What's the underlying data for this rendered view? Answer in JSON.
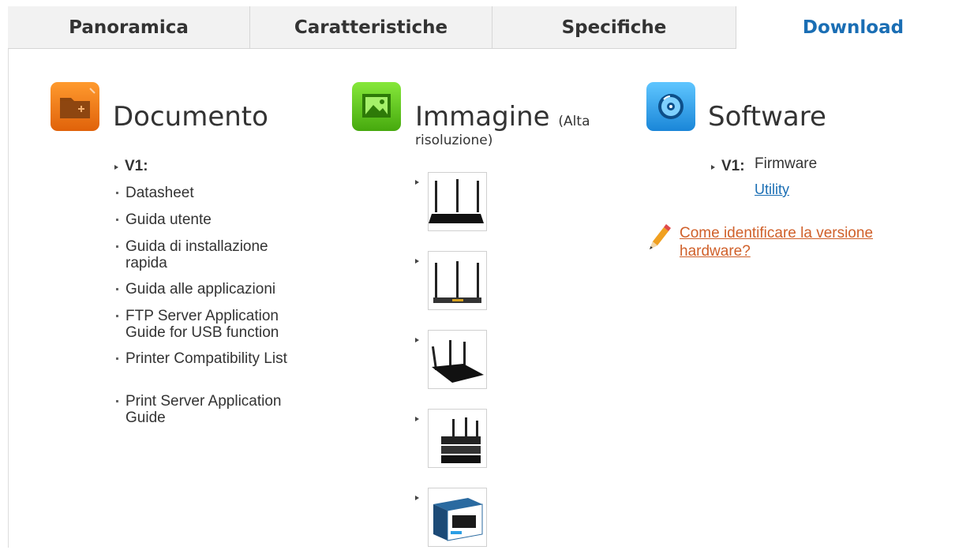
{
  "tabs": [
    {
      "label": "Panoramica"
    },
    {
      "label": "Caratteristiche"
    },
    {
      "label": "Specifiche"
    },
    {
      "label": "Download",
      "active": true
    }
  ],
  "documento": {
    "title": "Documento",
    "icon": "folder-icon",
    "color": "#f07a10",
    "version": "V1:",
    "items": [
      "Datasheet",
      "Guida utente",
      "Guida di installazione rapida",
      "Guida alle applicazioni",
      "FTP Server Application Guide for USB function",
      "Printer Compatibility List",
      "Print Server Application Guide"
    ]
  },
  "immagine": {
    "title": "Immagine",
    "subtitle_a": "(Alta",
    "subtitle_b": "risoluzione)",
    "icon": "picture-icon",
    "color": "#5fbf1c",
    "thumbnails": [
      "router-front-image",
      "router-back-image",
      "router-angle-image",
      "router-stack-image",
      "router-box-image"
    ]
  },
  "software": {
    "title": "Software",
    "icon": "disc-icon",
    "color": "#2a9fe6",
    "version": "V1:",
    "firmware": "Firmware",
    "utility": "Utility",
    "help_link": "Come identificare la versione hardware?"
  }
}
